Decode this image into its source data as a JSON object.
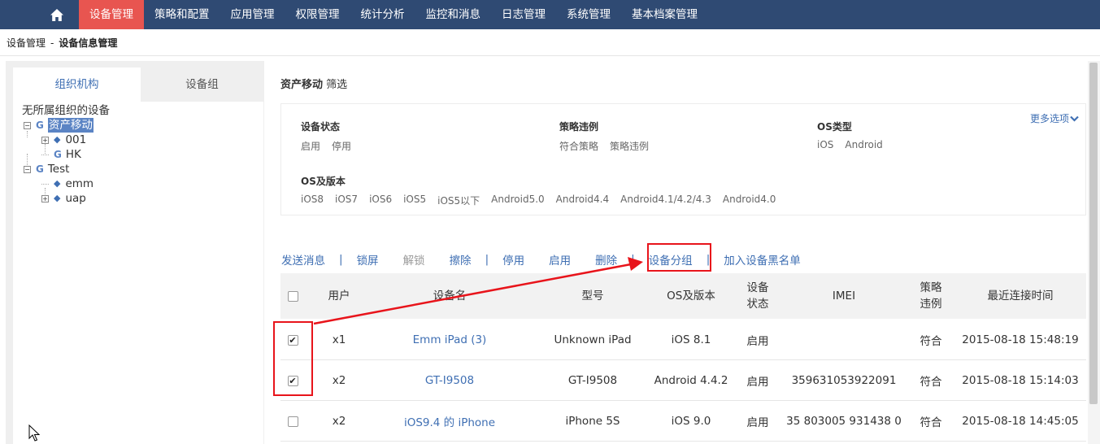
{
  "nav": {
    "home_icon": "home-icon",
    "items": [
      {
        "label": "设备管理",
        "active": true
      },
      {
        "label": "策略和配置"
      },
      {
        "label": "应用管理"
      },
      {
        "label": "权限管理"
      },
      {
        "label": "统计分析"
      },
      {
        "label": "监控和消息"
      },
      {
        "label": "日志管理"
      },
      {
        "label": "系统管理"
      },
      {
        "label": "基本档案管理"
      }
    ]
  },
  "breadcrumb": {
    "parent": "设备管理",
    "sep": "-",
    "current": "设备信息管理"
  },
  "left": {
    "tabs": [
      {
        "label": "组织机构"
      },
      {
        "label": "设备组"
      }
    ],
    "tree": {
      "root": "无所属组织的设备",
      "nodes": {
        "asset": "资产移动",
        "n001": "001",
        "hk": "HK",
        "test": "Test",
        "emm": "emm",
        "uap": "uap"
      },
      "g_letter": "G",
      "diamond": "◆",
      "plus": "+",
      "minus": "−"
    }
  },
  "filter": {
    "title": "资产移动",
    "subtitle": "筛选",
    "more": "更多选项",
    "groups": {
      "device_status": {
        "label": "设备状态",
        "options": [
          "启用",
          "停用"
        ]
      },
      "policy": {
        "label": "策略违例",
        "options": [
          "符合策略",
          "策略违例"
        ]
      },
      "os_type": {
        "label": "OS类型",
        "options": [
          "iOS",
          "Android"
        ]
      },
      "os_version": {
        "label": "OS及版本",
        "options": [
          "iOS8",
          "iOS7",
          "iOS6",
          "iOS5",
          "iOS5以下",
          "Android5.0",
          "Android4.4",
          "Android4.1/4.2/4.3",
          "Android4.0"
        ]
      }
    }
  },
  "toolbar": {
    "send": "发送消息",
    "lock": "锁屏",
    "unlock": "解锁",
    "wipe": "擦除",
    "disable": "停用",
    "enable": "启用",
    "delete": "删除",
    "group": "设备分组",
    "blacklist": "加入设备黑名单",
    "sep": "|"
  },
  "table": {
    "headers": {
      "user": "用户",
      "name": "设备名",
      "model": "型号",
      "os": "OS及版本",
      "status_l1": "设备",
      "status_l2": "状态",
      "imei": "IMEI",
      "policy_l1": "策略",
      "policy_l2": "违例",
      "last": "最近连接时间"
    },
    "rows": [
      {
        "checked": true,
        "user": "x1",
        "name": "Emm iPad (3)",
        "model": "Unknown iPad",
        "os": "iOS 8.1",
        "status": "启用",
        "imei": "",
        "policy": "符合",
        "last": "2015-08-18 15:48:19"
      },
      {
        "checked": true,
        "user": "x2",
        "name": "GT-I9508",
        "model": "GT-I9508",
        "os": "Android 4.4.2",
        "status": "启用",
        "imei": "359631053922091",
        "policy": "符合",
        "last": "2015-08-18 15:14:03"
      },
      {
        "checked": false,
        "user": "x2",
        "name": "iOS9.4 的 iPhone",
        "model": "iPhone 5S",
        "os": "iOS 9.0",
        "status": "启用",
        "imei": "35 803005 931438 0",
        "policy": "符合",
        "last": "2015-08-18 14:45:05"
      }
    ],
    "check_mark": "✔"
  },
  "colors": {
    "nav_bg": "#2f4a73",
    "nav_active": "#e85550",
    "link": "#3f6fb3",
    "annotation": "#e8141b"
  }
}
